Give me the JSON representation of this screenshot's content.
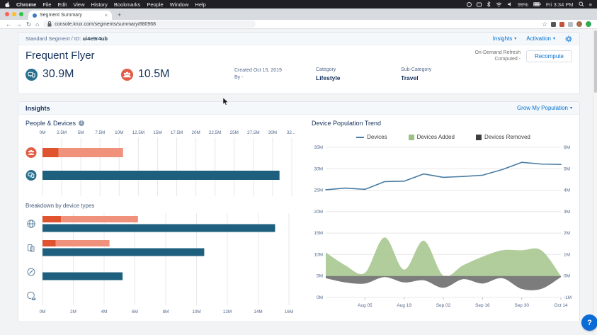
{
  "menubar": {
    "app": "Chrome",
    "items": [
      "File",
      "Edit",
      "View",
      "History",
      "Bookmarks",
      "People",
      "Window",
      "Help"
    ],
    "status": {
      "battery": "99%",
      "clock": "Fri 3:34 PM"
    }
  },
  "browser": {
    "tab_title": "Segment Summary",
    "url": "console.krux.com/segments/summary/880968"
  },
  "icons": {
    "back": "←",
    "forward": "→",
    "reload": "↻",
    "home": "⌂",
    "star": "☆",
    "overflow": "⋮",
    "caret": "▾",
    "hamburger": "≡",
    "close": "×",
    "plus": "+",
    "help": "?",
    "info": "i"
  },
  "segment_header": {
    "breadcrumb": "Standard Segment / ID:",
    "segment_id": "ui4e9r4ub",
    "insights_menu": "Insights",
    "activation_menu": "Activation",
    "title": "Frequent Flyer",
    "refresh_line1": "On-Demand Refresh",
    "refresh_line2": "Computed -",
    "recompute_button": "Recompute",
    "devices_count": "30.9M",
    "people_count": "10.5M",
    "created_label": "Created Oct 15, 2019",
    "created_by": "By -",
    "category_label": "Category",
    "category_value": "Lifestyle",
    "subcategory_label": "Sub-Category",
    "subcategory_value": "Travel"
  },
  "insights": {
    "section_title": "Insights",
    "grow_link": "Grow My Population"
  },
  "colors": {
    "people_dark": "#e0532f",
    "people_light": "#f0917c",
    "devices_bar": "#1e5f7e",
    "people_icon_bg": "#e25c45",
    "devices_icon_bg": "#27708f",
    "trend_line": "#4a7ca3",
    "added_area": "#9dc183",
    "removed_area": "#4a4a4a",
    "grid": "#e8e8e8",
    "axis_text": "#54698d",
    "link": "#0070d2",
    "type_icon": "#64859e"
  },
  "chart_data": [
    {
      "id": "people_devices",
      "type": "bar",
      "orientation": "horizontal",
      "title": "People & Devices",
      "xlim": [
        0,
        32.5
      ],
      "x_tick_labels": [
        "0M",
        "2.5M",
        "5M",
        "7.5M",
        "10M",
        "12.5M",
        "15M",
        "17.5M",
        "20M",
        "22.5M",
        "25M",
        "27.5M",
        "30M",
        "32..."
      ],
      "rows": [
        {
          "name": "People",
          "icon": "people-icon",
          "segments": [
            {
              "start": 0,
              "end": 2.1,
              "color_key": "people_dark"
            },
            {
              "start": 2.1,
              "end": 10.5,
              "color_key": "people_light"
            }
          ]
        },
        {
          "name": "Devices",
          "icon": "devices-icon",
          "segments": [
            {
              "start": 0,
              "end": 30.9,
              "color_key": "devices_bar"
            }
          ]
        }
      ]
    },
    {
      "id": "breakdown_by_device_types",
      "type": "bar",
      "orientation": "horizontal",
      "title": "Breakdown by device types",
      "xlim": [
        0,
        16
      ],
      "x_tick_labels": [
        "0M",
        "2M",
        "4M",
        "6M",
        "8M",
        "10M",
        "12M",
        "14M",
        "16M"
      ],
      "rows": [
        {
          "name": "Browser",
          "icon": "globe-icon",
          "people_dark": 1.2,
          "people_total": 6.2,
          "devices": 15.1
        },
        {
          "name": "Mobile",
          "icon": "mobile-icon",
          "people_dark": 0.85,
          "people_total": 4.35,
          "devices": 10.5
        },
        {
          "name": "App",
          "icon": "app-icon",
          "people_dark": 0,
          "people_total": 0,
          "devices": 5.2
        },
        {
          "name": "Other",
          "icon": "other-icon",
          "people_dark": 0,
          "people_total": 0,
          "devices": 0
        }
      ]
    },
    {
      "id": "device_population_trend",
      "type": "line",
      "title": "Device Population Trend",
      "legend": [
        {
          "label": "Devices",
          "swatch": "line",
          "color_key": "trend_line"
        },
        {
          "label": "Devices Added",
          "swatch": "area",
          "color_key": "added_area"
        },
        {
          "label": "Devices Removed",
          "swatch": "area",
          "color_key": "removed_area"
        }
      ],
      "x_labels": [
        "Aug 05",
        "Aug 19",
        "Sep 02",
        "Sep 16",
        "Sep 30",
        "Oct 14"
      ],
      "x_label_indices": [
        2,
        4,
        6,
        8,
        10,
        12
      ],
      "left_axis": {
        "ticks": [
          "35M",
          "30M",
          "25M",
          "20M",
          "15M",
          "10M",
          "5M",
          "0M"
        ],
        "min": 0,
        "max": 35
      },
      "right_axis": {
        "ticks": [
          "6M",
          "5M",
          "4M",
          "3M",
          "2M",
          "1M",
          "0M",
          "-1M"
        ],
        "min": -1,
        "max": 6
      },
      "series": [
        {
          "name": "Devices",
          "axis": "left",
          "values": [
            25.1,
            25.5,
            25.2,
            27.0,
            27.1,
            28.8,
            28.0,
            28.2,
            28.5,
            29.8,
            31.5,
            31.1,
            31.0
          ]
        },
        {
          "name": "Devices Added",
          "axis": "right",
          "values": [
            1.1,
            0.5,
            0.15,
            1.8,
            0.3,
            1.65,
            0.02,
            0.5,
            0.9,
            1.2,
            1.2,
            1.2,
            0.0
          ]
        },
        {
          "name": "Devices Removed",
          "axis": "right",
          "values": [
            -0.1,
            -0.3,
            -0.35,
            -0.05,
            -0.3,
            -0.2,
            -0.55,
            -0.15,
            -0.35,
            -0.1,
            -0.6,
            -0.6,
            -0.05
          ]
        }
      ]
    }
  ]
}
